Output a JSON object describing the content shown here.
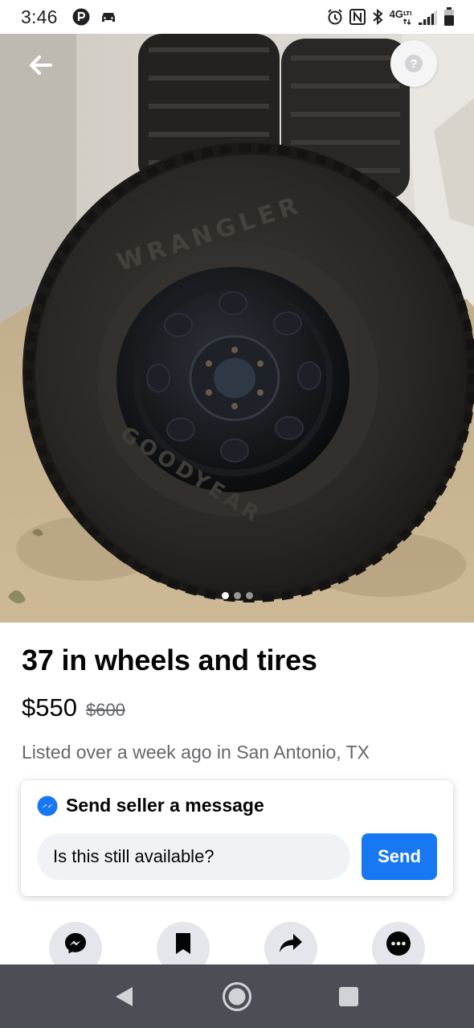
{
  "status_bar": {
    "time": "3:46",
    "network": "4G",
    "left_icons": [
      "parking-app-icon",
      "car-icon"
    ],
    "right_icons": [
      "alarm-icon",
      "nfc-icon",
      "bluetooth-icon",
      "lte-icon",
      "signal-icon",
      "battery-icon"
    ]
  },
  "hero": {
    "image_count": 3,
    "active_image_index": 0
  },
  "listing": {
    "title": "37 in wheels and tires",
    "price": "$550",
    "original_price": "$600",
    "listed_text": "Listed over a week ago in San Antonio, TX"
  },
  "message_card": {
    "title": "Send seller a message",
    "input_value": "Is this still available?",
    "send_label": "Send"
  },
  "actions": [
    {
      "icon": "messenger-icon"
    },
    {
      "icon": "save-icon"
    },
    {
      "icon": "share-icon"
    },
    {
      "icon": "more-icon"
    }
  ],
  "nav_bar": {
    "buttons": [
      "back-icon",
      "home-icon",
      "recents-icon"
    ]
  },
  "colors": {
    "accent": "#1877f2",
    "secondary_text": "#65676b",
    "input_bg": "#f0f2f5",
    "nav_bar": "#4b4f55"
  }
}
